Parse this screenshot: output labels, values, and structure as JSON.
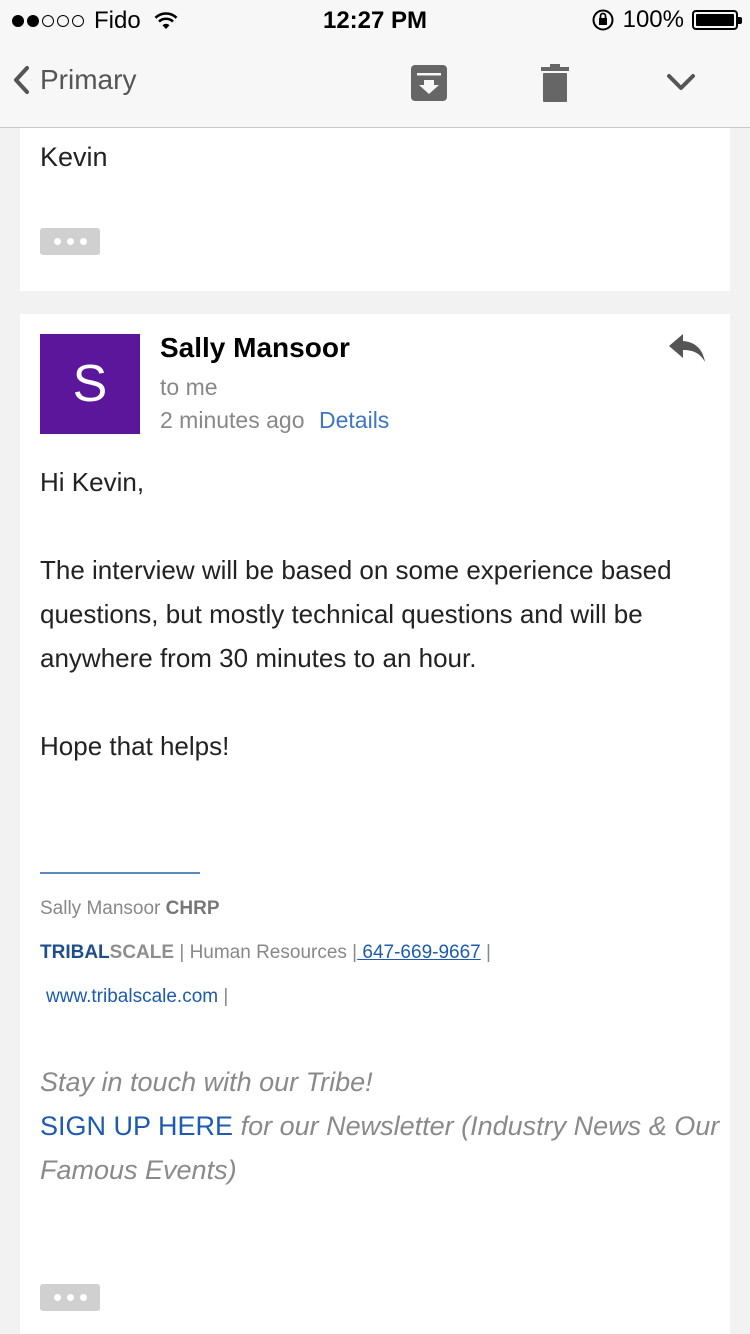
{
  "status_bar": {
    "carrier": "Fido",
    "signal_bars_filled": 2,
    "signal_bars_total": 5,
    "time": "12:27 PM",
    "battery": "100%"
  },
  "nav": {
    "back_label": "Primary",
    "icons": [
      "archive-icon",
      "trash-icon",
      "chevron-down-icon"
    ]
  },
  "previous_message": {
    "signoff": "Kevin"
  },
  "message": {
    "avatar_letter": "S",
    "avatar_color": "#5c169b",
    "sender": "Sally Mansoor",
    "recipient": "to me",
    "time": "2 minutes ago",
    "details_link": "Details",
    "greeting": "Hi Kevin,",
    "paragraph": "The interview will be based on some experience based questions, but mostly technical questions and will be anywhere from 30 minutes to an hour.",
    "closing": "Hope that helps!"
  },
  "signature": {
    "name": "Sally Mansoor",
    "credential": "CHRP",
    "company_part1": "TRIBAL",
    "company_part2": "SCALE",
    "sep1": " | ",
    "department": "Human Resources",
    "sep2": " |",
    "phone": " 647-669-9667",
    "sep3": " |",
    "website": "www.tribalscale.com",
    "sep4": " |"
  },
  "newsletter": {
    "line1": "Stay in touch with our Tribe!",
    "signup_link": "SIGN UP HERE",
    "line2": " for our Newsletter (Industry News & Our Famous Events)"
  },
  "colors": {
    "link": "#3f75c6",
    "brand": "#1f4e8d"
  }
}
